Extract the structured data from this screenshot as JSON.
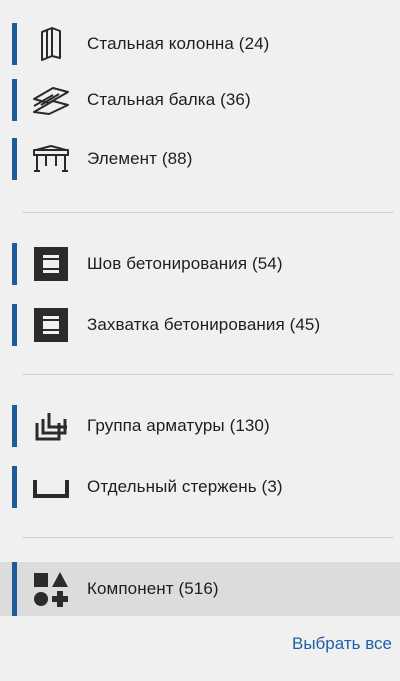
{
  "groups": [
    [
      {
        "label": "Стальная колонна (24)",
        "icon": "steel-column-icon"
      },
      {
        "label": "Стальная балка (36)",
        "icon": "steel-beam-icon"
      },
      {
        "label": "Элемент (88)",
        "icon": "element-icon"
      }
    ],
    [
      {
        "label": "Шов бетонирования (54)",
        "icon": "pour-break-icon"
      },
      {
        "label": "Захватка бетонирования (45)",
        "icon": "pour-unit-icon"
      }
    ],
    [
      {
        "label": "Группа арматуры (130)",
        "icon": "rebar-group-icon"
      },
      {
        "label": "Отдельный стержень (3)",
        "icon": "single-rebar-icon"
      }
    ],
    [
      {
        "label": "Компонент (516)",
        "icon": "component-icon",
        "selected": true
      }
    ]
  ],
  "select_all_label": "Выбрать все",
  "colors": {
    "accent": "#1e5c98",
    "link": "#1f5fa6",
    "selected_bg": "#dcdcdc",
    "background": "#f0f0f0"
  }
}
